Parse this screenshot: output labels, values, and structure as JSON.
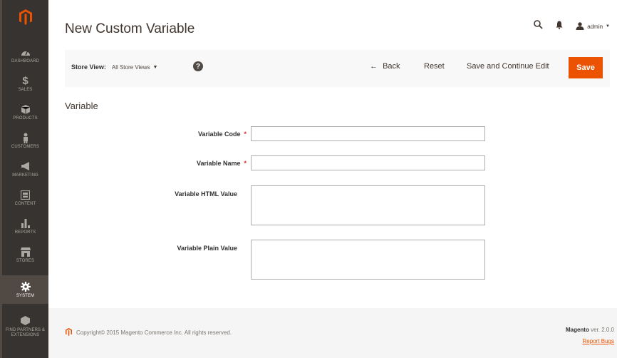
{
  "sidebar": {
    "items": [
      {
        "label": "DASHBOARD",
        "icon": "speedometer-icon"
      },
      {
        "label": "SALES",
        "icon": "dollar-icon"
      },
      {
        "label": "PRODUCTS",
        "icon": "cube-icon"
      },
      {
        "label": "CUSTOMERS",
        "icon": "person-icon"
      },
      {
        "label": "MARKETING",
        "icon": "megaphone-icon"
      },
      {
        "label": "CONTENT",
        "icon": "content-icon"
      },
      {
        "label": "REPORTS",
        "icon": "bar-chart-icon"
      },
      {
        "label": "STORES",
        "icon": "store-icon"
      },
      {
        "label": "SYSTEM",
        "icon": "gear-icon"
      },
      {
        "label": "FIND PARTNERS & EXTENSIONS",
        "icon": "extensions-icon"
      }
    ],
    "active": "SYSTEM"
  },
  "header": {
    "title": "New Custom Variable",
    "user": "admin"
  },
  "toolbar": {
    "scope_label": "Store View:",
    "scope_value": "All Store Views",
    "back_label": "Back",
    "reset_label": "Reset",
    "save_continue_label": "Save and Continue Edit",
    "save_label": "Save"
  },
  "form": {
    "section_title": "Variable",
    "fields": [
      {
        "label": "Variable Code",
        "required": true,
        "value": ""
      },
      {
        "label": "Variable Name",
        "required": true,
        "value": ""
      },
      {
        "label": "Variable HTML Value",
        "required": false,
        "value": ""
      },
      {
        "label": "Variable Plain Value",
        "required": false,
        "value": ""
      }
    ]
  },
  "footer": {
    "copyright": "Copyright© 2015 Magento Commerce Inc. All rights reserved.",
    "brand": "Magento",
    "version": "ver. 2.0.0",
    "report_bugs": "Report Bugs"
  },
  "colors": {
    "accent": "#eb5202",
    "sidebar_bg": "#373330",
    "sidebar_active": "#514943"
  }
}
